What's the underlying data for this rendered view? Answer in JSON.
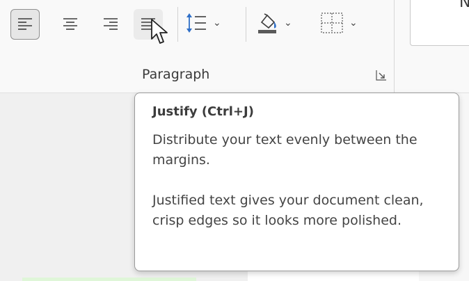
{
  "ribbon": {
    "group_label": "Paragraph",
    "style_preview_text": "N",
    "buttons": [
      {
        "name": "align-left",
        "icon": "align-left-icon",
        "selected": true
      },
      {
        "name": "align-center",
        "icon": "align-center-icon"
      },
      {
        "name": "align-right",
        "icon": "align-right-icon"
      },
      {
        "name": "justify",
        "icon": "justify-icon",
        "hovered": true
      },
      {
        "name": "line-spacing",
        "icon": "line-spacing-icon"
      },
      {
        "name": "shading",
        "icon": "paint-bucket-icon"
      },
      {
        "name": "borders",
        "icon": "borders-icon"
      }
    ]
  },
  "tooltip": {
    "title": "Justify (Ctrl+J)",
    "description": "Distribute your text evenly between the margins.",
    "detail": "Justified text gives your document clean, crisp edges so it looks more polished."
  },
  "colors": {
    "ribbon_bg": "#f9f9f9",
    "selected_border": "#8f8f8f",
    "link": "#2b5fa8",
    "shading_bar": "#5a5a5a"
  }
}
